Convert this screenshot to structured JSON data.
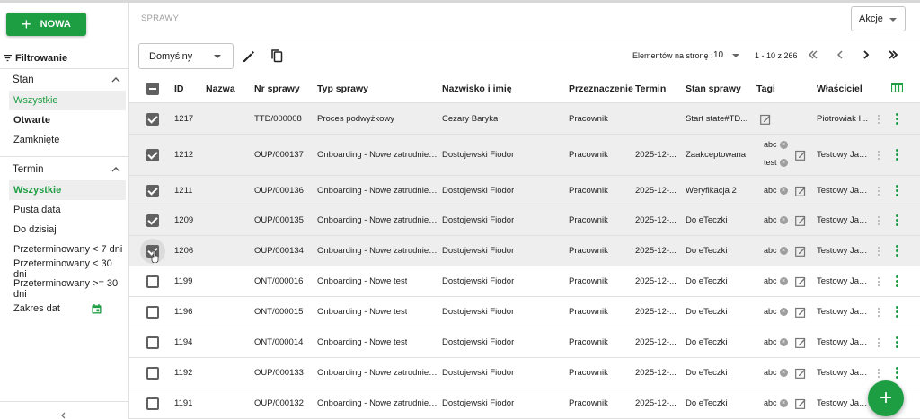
{
  "sidebar": {
    "new_button": "NOWA",
    "filter_title": "Filtrowanie",
    "stan": {
      "title": "Stan",
      "items": [
        "Wszystkie",
        "Otwarte",
        "Zamknięte"
      ]
    },
    "termin": {
      "title": "Termin",
      "items": [
        "Wszystkie",
        "Pusta data",
        "Do dzisiaj",
        "Przeterminowany < 7 dni",
        "Przeterminowany < 30 dni",
        "Przeterminowany >= 30 dni",
        "Zakres dat"
      ]
    }
  },
  "header": {
    "breadcrumb": "SPRAWY",
    "actions_label": "Akcje"
  },
  "toolbar": {
    "view": "Domyślny",
    "page_size_label": "Elementów na stronę :",
    "page_size": "10",
    "range": "1 - 10 z 266"
  },
  "table": {
    "columns": [
      "ID",
      "Nazwa",
      "Nr sprawy",
      "Typ sprawy",
      "Nazwisko i imię",
      "Przeznaczenie",
      "Termin",
      "Stan sprawy",
      "Tagi",
      "Właściciel"
    ],
    "rows": [
      {
        "id": "1217",
        "nr": "TTD/000008",
        "typ": "Proces podwyżkowy",
        "nazwisko": "Cezary Baryka",
        "przeznaczenie": "Pracownik",
        "termin": "",
        "stan": "Start state#TD...",
        "tags": [],
        "wlasciciel": "Piotrowiak I...",
        "checked": true
      },
      {
        "id": "1212",
        "nr": "OUP/000137",
        "typ": "Onboarding - Nowe zatrudnien...",
        "nazwisko": "Dostojewski Fiodor",
        "przeznaczenie": "Pracownik",
        "termin": "2025-12-...",
        "stan": "Zaakceptowana",
        "tags": [
          "abc",
          "test"
        ],
        "wlasciciel": "Testowy Jan...",
        "checked": true
      },
      {
        "id": "1211",
        "nr": "OUP/000136",
        "typ": "Onboarding - Nowe zatrudnien...",
        "nazwisko": "Dostojewski Fiodor",
        "przeznaczenie": "Pracownik",
        "termin": "2025-12-...",
        "stan": "Weryfikacja 2",
        "tags": [
          "abc"
        ],
        "wlasciciel": "Testowy Jan...",
        "checked": true
      },
      {
        "id": "1209",
        "nr": "OUP/000135",
        "typ": "Onboarding - Nowe zatrudnien...",
        "nazwisko": "Dostojewski Fiodor",
        "przeznaczenie": "Pracownik",
        "termin": "2025-12-...",
        "stan": "Do eTeczki",
        "tags": [
          "abc"
        ],
        "wlasciciel": "Testowy Jan...",
        "checked": true
      },
      {
        "id": "1206",
        "nr": "OUP/000134",
        "typ": "Onboarding - Nowe zatrudnien...",
        "nazwisko": "Dostojewski Fiodor",
        "przeznaczenie": "Pracownik",
        "termin": "2025-12-...",
        "stan": "Do eTeczki",
        "tags": [
          "abc"
        ],
        "wlasciciel": "Testowy Jan...",
        "checked": true
      },
      {
        "id": "1199",
        "nr": "ONT/000016",
        "typ": "Onboarding - Nowe test",
        "nazwisko": "Dostojewski Fiodor",
        "przeznaczenie": "Pracownik",
        "termin": "2025-12-...",
        "stan": "Do eTeczki",
        "tags": [
          "abc"
        ],
        "wlasciciel": "Testowy Jan...",
        "checked": false
      },
      {
        "id": "1196",
        "nr": "ONT/000015",
        "typ": "Onboarding - Nowe test",
        "nazwisko": "Dostojewski Fiodor",
        "przeznaczenie": "Pracownik",
        "termin": "2025-12-...",
        "stan": "Do eTeczki",
        "tags": [
          "abc"
        ],
        "wlasciciel": "Testowy Jan...",
        "checked": false
      },
      {
        "id": "1194",
        "nr": "ONT/000014",
        "typ": "Onboarding - Nowe test",
        "nazwisko": "Dostojewski Fiodor",
        "przeznaczenie": "Pracownik",
        "termin": "2025-12-...",
        "stan": "Do eTeczki",
        "tags": [
          "abc"
        ],
        "wlasciciel": "Testowy Jan...",
        "checked": false
      },
      {
        "id": "1192",
        "nr": "OUP/000133",
        "typ": "Onboarding - Nowe zatrudnien...",
        "nazwisko": "Dostojewski Fiodor",
        "przeznaczenie": "Pracownik",
        "termin": "2025-12-...",
        "stan": "Do eTeczki",
        "tags": [
          "abc"
        ],
        "wlasciciel": "Testowy Jan...",
        "checked": false
      },
      {
        "id": "1191",
        "nr": "OUP/000132",
        "typ": "Onboarding - Nowe zatrudnien...",
        "nazwisko": "Dostojewski Fiodor",
        "przeznaczenie": "Pracownik",
        "termin": "2025-12-...",
        "stan": "Do eTeczki",
        "tags": [
          "abc"
        ],
        "wlasciciel": "Testowy Jan...",
        "checked": false
      }
    ]
  },
  "fab_label": "+",
  "colors": {
    "accent": "#1e9e43",
    "selected_row": "#eeeeee"
  }
}
